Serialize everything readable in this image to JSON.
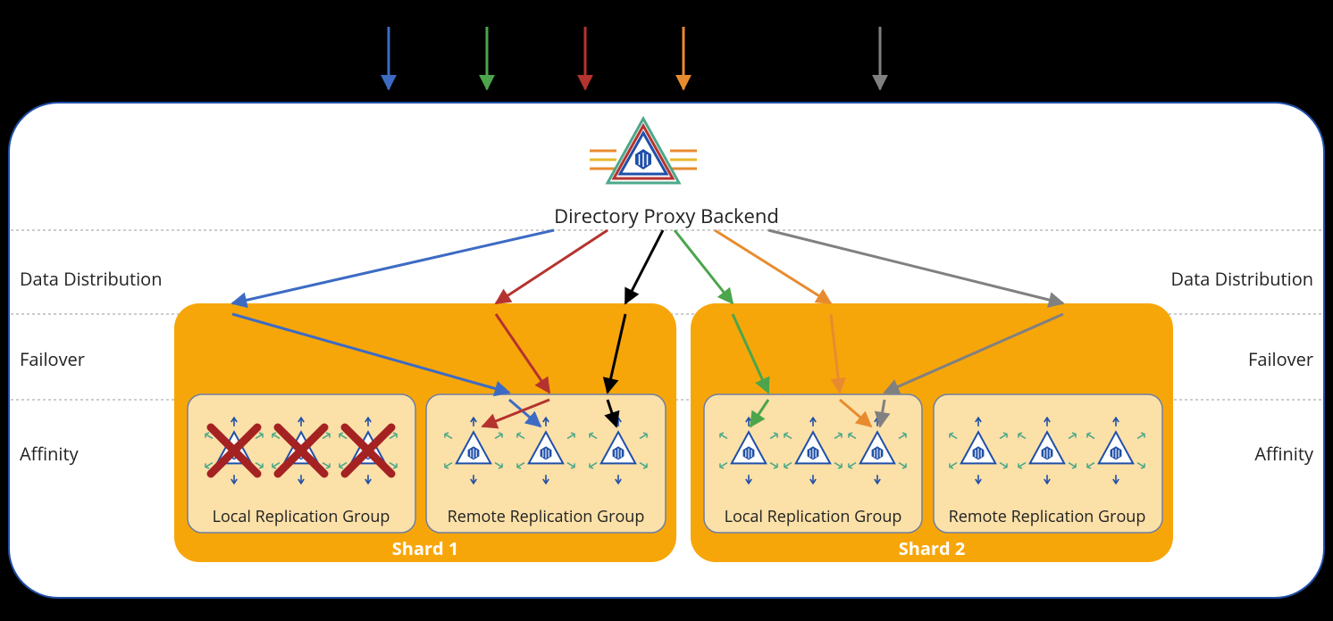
{
  "title": "Directory Proxy Backend",
  "rowLabels": {
    "dataDistributionLeft": "Data Distribution",
    "dataDistributionRight": "Data Distribution",
    "failoverLeft": "Failover",
    "failoverRight": "Failover",
    "affinityLeft": "Affinity",
    "affinityRight": "Affinity"
  },
  "shards": {
    "shard1": {
      "label": "Shard 1",
      "groups": {
        "local": "Local Replication Group",
        "remote": "Remote Replication Group"
      }
    },
    "shard2": {
      "label": "Shard 2",
      "groups": {
        "local": "Local Replication Group",
        "remote": "Remote Replication Group"
      }
    }
  },
  "colors": {
    "blue": "#3d6bc4",
    "green": "#4ca54c",
    "red": "#b5332f",
    "orange": "#e88b2f",
    "gray": "#808080",
    "black": "#000000",
    "shard": "#f7a60a",
    "group": "#fbe0a8",
    "border": "#1f4fa8",
    "darkred": "#a52222"
  }
}
